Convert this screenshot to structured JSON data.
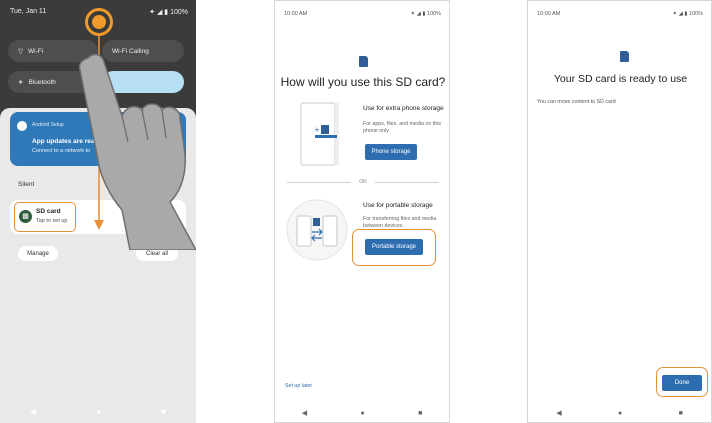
{
  "phone1": {
    "status_date": "Tue, Jan 11",
    "status_right": "✦ ◢ ▮ 100%",
    "tiles": [
      {
        "label": "Wi-Fi",
        "icon": "wifi-icon"
      },
      {
        "label": "Wi-Fi Calling",
        "icon": "wifi-calling-icon"
      },
      {
        "label": "Bluetooth",
        "icon": "bluetooth-icon"
      }
    ],
    "android_notif": {
      "app": "Android Setup",
      "title": "App updates are ready",
      "text": "Connect to a network to"
    },
    "silent_label": "Silent",
    "sd_notif": {
      "title": "SD card",
      "text": "Tap to set up"
    },
    "manage_label": "Manage",
    "clear_label": "Clear all",
    "nav": [
      "◀",
      "●",
      "■"
    ]
  },
  "phone2": {
    "status_time": "10:00 AM",
    "status_right": "✦ ◢ ▮ 100%",
    "title": "How will you use this SD card?",
    "option1": {
      "title": "Use for extra phone storage",
      "desc": "For apps, files, and media on this phone only",
      "button": "Phone storage"
    },
    "or_text": "OR",
    "option2": {
      "title": "Use for portable storage",
      "desc": "For transferring files and media between devices",
      "button": "Portable storage"
    },
    "later_link": "Set up later",
    "nav": [
      "◀",
      "●",
      "■"
    ]
  },
  "phone3": {
    "status_time": "10:00 AM",
    "status_right": "✦ ◢ ▮ 100%",
    "title": "Your SD card is ready to use",
    "desc": "You can move content to SD card",
    "done_button": "Done",
    "nav": [
      "◀",
      "●",
      "■"
    ]
  },
  "colors": {
    "accent_blue": "#2f6db1",
    "highlight_orange": "#e6913a",
    "shade_dark": "#3b3b3b"
  }
}
